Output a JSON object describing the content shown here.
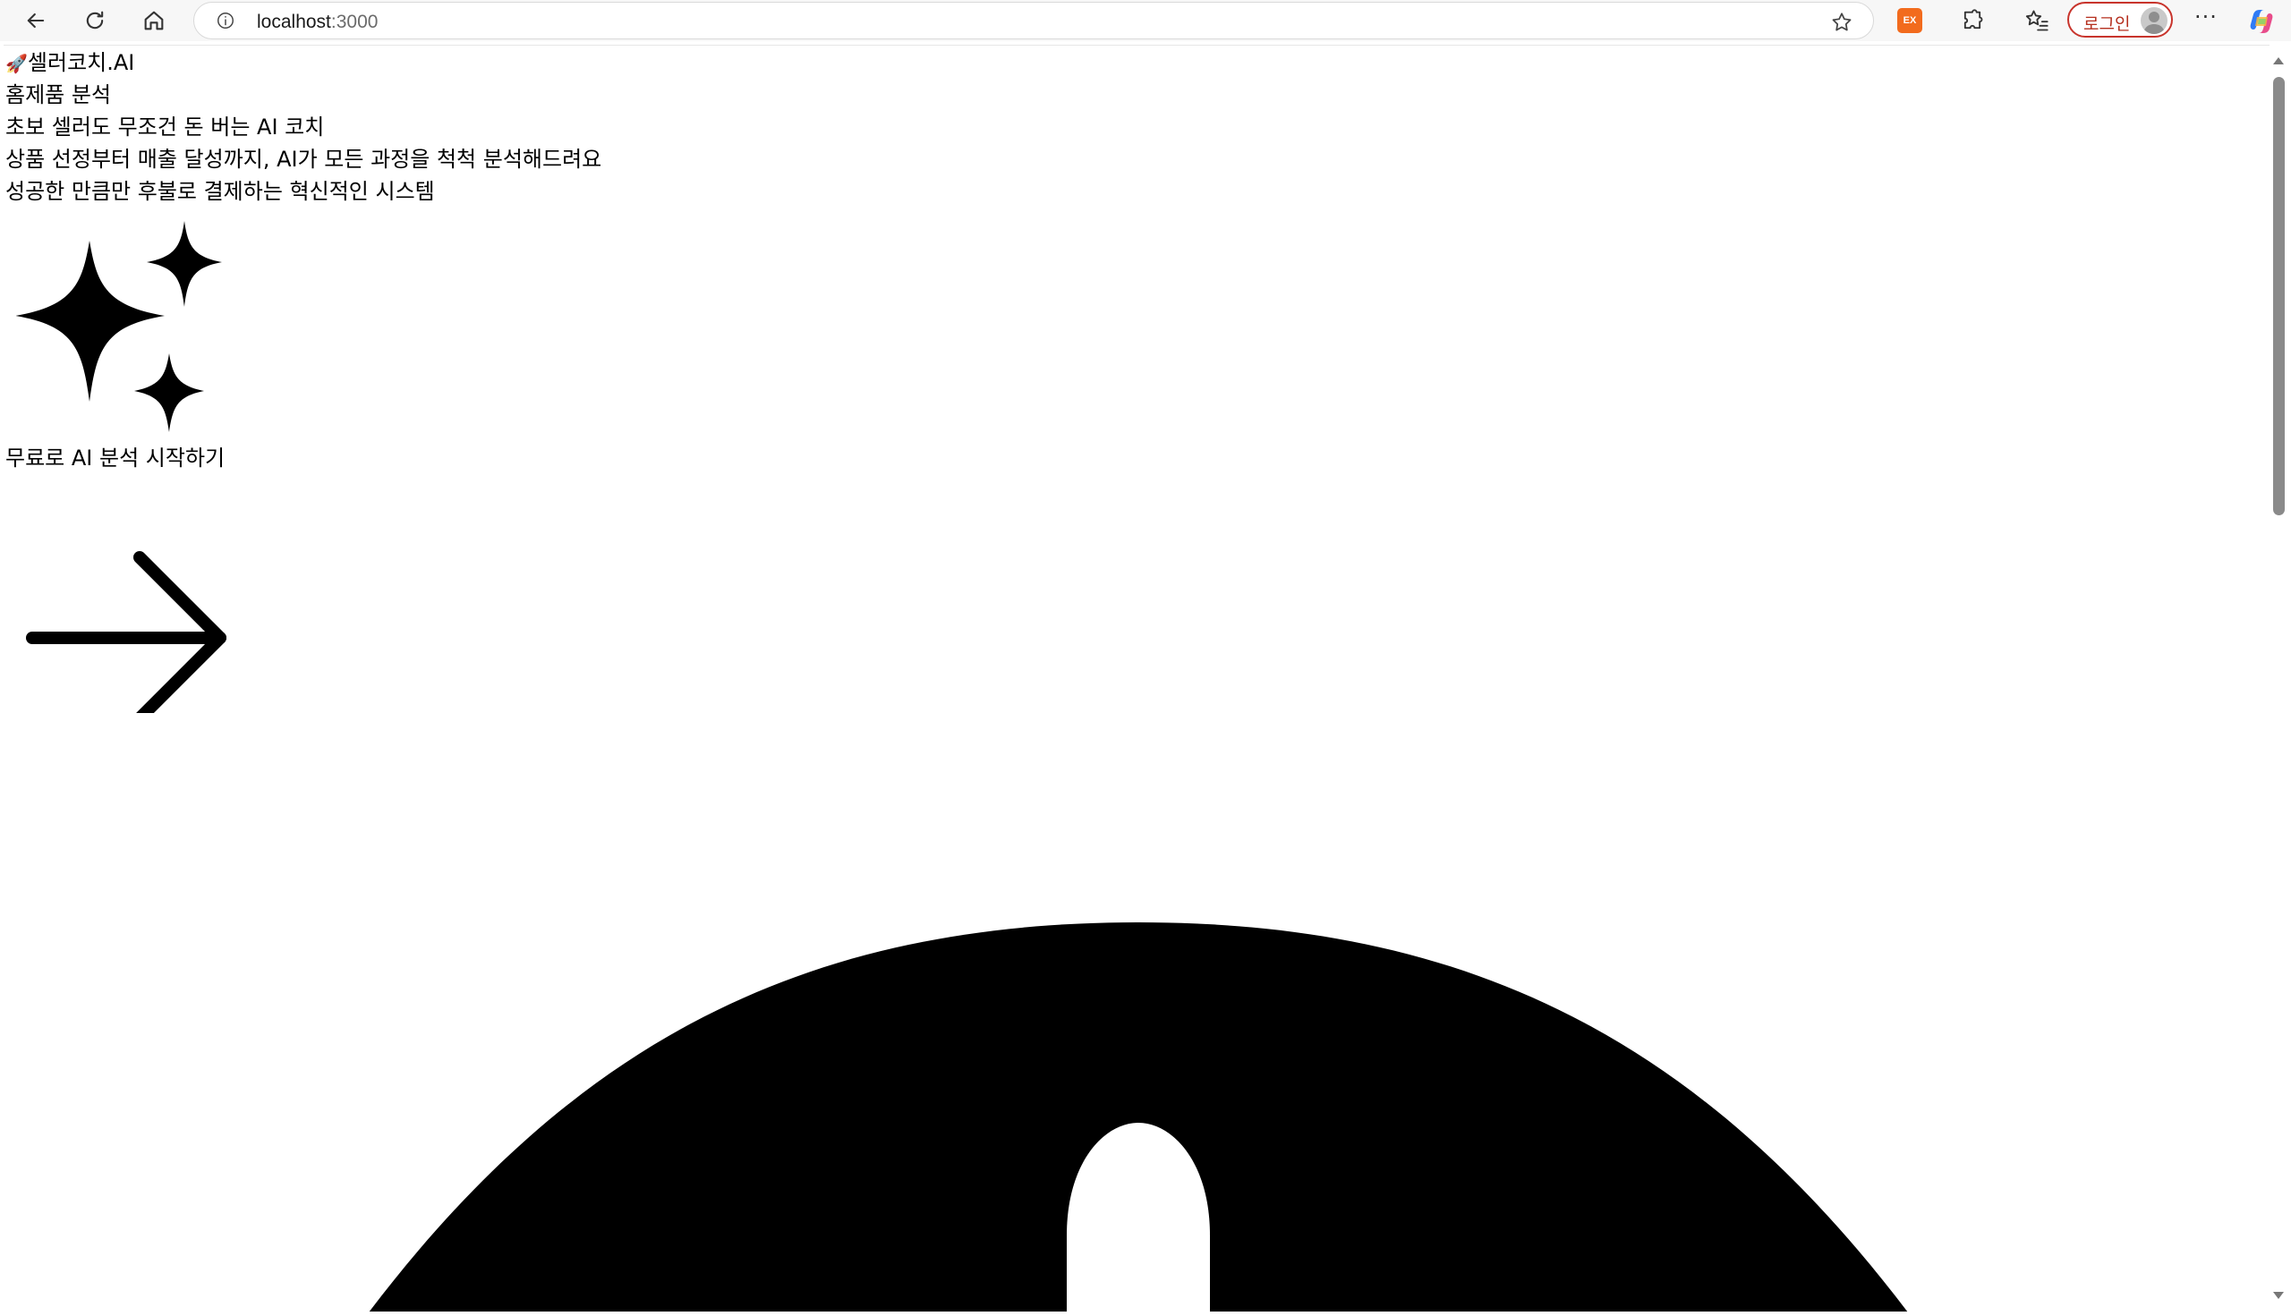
{
  "browser": {
    "url_host": "localhost",
    "url_port": ":3000",
    "extension_badge": "EX",
    "profile_label": "로그인",
    "more_label": "···",
    "icons": {
      "back": "back-arrow-icon",
      "reload": "reload-icon",
      "home": "home-icon",
      "site_info": "info-icon",
      "favorite": "star-icon",
      "extensions": "puzzle-icon",
      "favorites": "favorites-list-icon",
      "profile": "avatar-icon",
      "copilot": "copilot-icon"
    },
    "colors": {
      "ext_badge": "#f26b1d",
      "profile_border": "#c8342c"
    }
  },
  "page": {
    "brand_emoji": "🚀",
    "brand_name": "셀러코치.AI",
    "nav_link": "홈제품 분석",
    "hero_title": "초보 셀러도 무조건 돈 버는 AI 코치",
    "hero_subtitle_1": "상품 선정부터 매출 달성까지, AI가 모든 과정을 척척 분석해드려요",
    "hero_subtitle_2": "성공한 만큼만 후불로 결제하는 혁신적인 시스템",
    "cta_label": "무료로 AI 분석 시작하기",
    "icons": {
      "sparkles": "sparkles-icon",
      "cta_arrow": "arrow-right-icon",
      "large_graphic": "rocket-body-icon"
    }
  }
}
